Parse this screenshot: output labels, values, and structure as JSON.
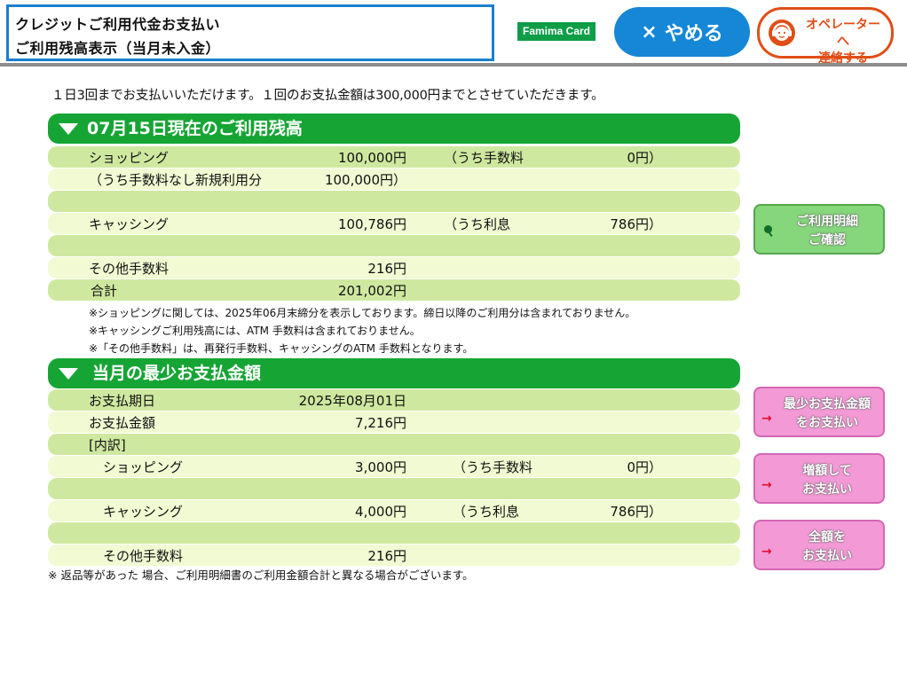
{
  "header": {
    "title_line1": "クレジットご利用代金お支払い",
    "title_line2": "ご利用残高表示（当月未入金）",
    "logo_text": "Famima Card",
    "cancel_symbol": "×",
    "cancel_label": "やめる",
    "operator_line1": "オペレーターへ",
    "operator_line2": "連絡する"
  },
  "intro": "１日3回までお支払いいただけます。１回のお支払金額は300,000円までとさせていただきます。",
  "section1": {
    "title": "07月15日現在のご利用残高",
    "rows": [
      {
        "label": "ショッピング",
        "amount": "100,000円",
        "sub_label": "（うち手数料",
        "sub_amount": "0円）"
      },
      {
        "label": "（うち手数料なし新規利用分",
        "amount": "100,000円）",
        "sub_label": "",
        "sub_amount": ""
      },
      {
        "label": "",
        "amount": "",
        "sub_label": "",
        "sub_amount": ""
      },
      {
        "label": "キャッシング",
        "amount": "100,786円",
        "sub_label": "（うち利息",
        "sub_amount": "786円）"
      },
      {
        "label": "",
        "amount": "",
        "sub_label": "",
        "sub_amount": ""
      },
      {
        "label": "その他手数料",
        "amount": "216円",
        "sub_label": "",
        "sub_amount": ""
      },
      {
        "label": "合計",
        "amount": "201,002円",
        "sub_label": "",
        "sub_amount": ""
      }
    ],
    "notes": [
      "※ショッピングに関しては、2025年06月末締分を表示しております。締日以降のご利用分は含まれておりません。",
      "※キャッシングご利用残高には、ATM 手数料は含まれておりません。",
      "※「その他手数料」は、再発行手数料、キャッシングのATM 手数料となります。"
    ]
  },
  "section2": {
    "title": "当月の最少お支払金額",
    "rows": [
      {
        "label": "お支払期日",
        "amount": "2025年08月01日",
        "sub_label": "",
        "sub_amount": ""
      },
      {
        "label": "お支払金額",
        "amount": "7,216円",
        "sub_label": "",
        "sub_amount": ""
      },
      {
        "label": "[内訳]",
        "amount": "",
        "sub_label": "",
        "sub_amount": ""
      },
      {
        "label": "ショッピング",
        "amount": "3,000円",
        "sub_label": "（うち手数料",
        "sub_amount": "0円）"
      },
      {
        "label": "",
        "amount": "",
        "sub_label": "",
        "sub_amount": ""
      },
      {
        "label": "キャッシング",
        "amount": "4,000円",
        "sub_label": "（うち利息",
        "sub_amount": "786円）"
      },
      {
        "label": "",
        "amount": "",
        "sub_label": "",
        "sub_amount": ""
      },
      {
        "label": "その他手数料",
        "amount": "216円",
        "sub_label": "",
        "sub_amount": ""
      }
    ]
  },
  "bottom_note": "※ 返品等があった 場合、ご利用明細書のご利用金額合計と異なる場合がございます。",
  "side_buttons": {
    "details": {
      "line1": "ご利用明細",
      "line2": "ご確認"
    },
    "min_pay": {
      "line1": "最少お支払金額",
      "line2": "をお支払い"
    },
    "increase_pay": {
      "line1": "増額して",
      "line2": "お支払い"
    },
    "full_pay": {
      "line1": "全額を",
      "line2": "お支払い"
    },
    "arrow": "→"
  },
  "colors": {
    "header_border": "#1a7fd0",
    "section_green": "#16a535",
    "row_dark": "#cfe8a0",
    "row_light": "#f1fad2",
    "cancel_blue": "#1587d6",
    "operator_orange": "#e04e17",
    "pink_button": "#f39ad6",
    "green_button": "#86d67c"
  },
  "icons": {
    "section_marker": "triangle-down-icon",
    "operator": "operator-headset-icon",
    "details": "magnifier-icon",
    "pay": "arrow-right-icon"
  }
}
